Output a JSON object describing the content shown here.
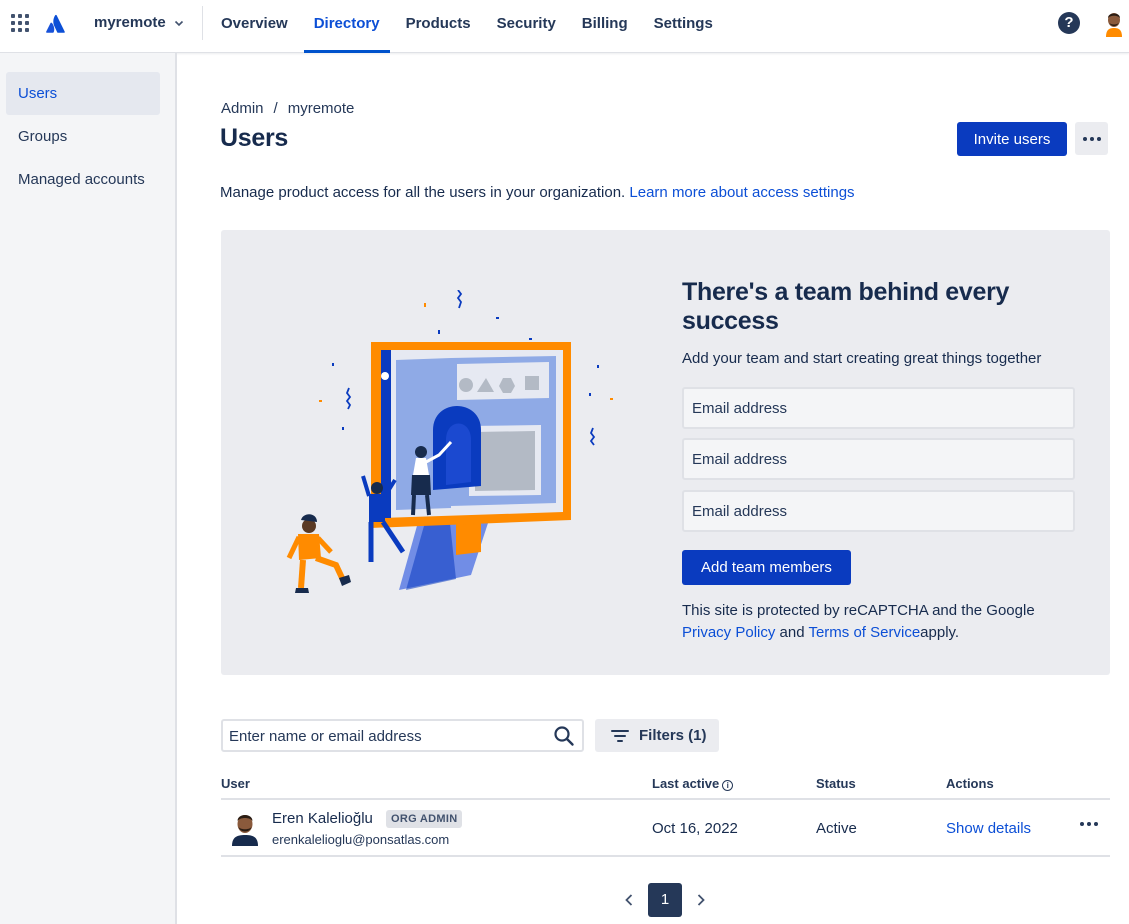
{
  "header": {
    "org_name": "myremote",
    "tabs": [
      {
        "label": "Overview"
      },
      {
        "label": "Directory"
      },
      {
        "label": "Products"
      },
      {
        "label": "Security"
      },
      {
        "label": "Billing"
      },
      {
        "label": "Settings"
      }
    ],
    "active_tab": "Directory",
    "help_symbol": "?"
  },
  "sidebar": {
    "items": [
      {
        "label": "Users"
      },
      {
        "label": "Groups"
      },
      {
        "label": "Managed accounts"
      }
    ],
    "active_item": "Users"
  },
  "main": {
    "breadcrumb": [
      "Admin",
      "/",
      "myremote"
    ],
    "title": "Users",
    "invite_button": "Invite users",
    "description": "Manage product access for all the users in your organization.",
    "description_link": "Learn more about access settings"
  },
  "promo": {
    "title": "There's a team behind every success",
    "subtitle": "Add your team and start creating great things together",
    "email_placeholder": "Email address",
    "add_button": "Add team members",
    "captcha_text_1": "This site is protected by reCAPTCHA and the Google",
    "privacy_link": "Privacy Policy",
    "and_text": "and",
    "terms_link": "Terms of Service",
    "apply_text": "apply."
  },
  "search": {
    "placeholder": "Enter name or email address",
    "filter_label": "Filters (1)"
  },
  "table": {
    "columns": {
      "user": "User",
      "last_active": "Last active",
      "status": "Status",
      "actions": "Actions"
    },
    "rows": [
      {
        "name": "Eren Kalelioğlu",
        "badge": "ORG ADMIN",
        "email": "erenkalelioglu@ponsatlas.com",
        "last_active": "Oct 16, 2022",
        "status": "Active",
        "action": "Show details"
      }
    ]
  },
  "pagination": {
    "current_page": "1"
  },
  "colors": {
    "primary": "#0a3bbf",
    "link": "#0c4fd6",
    "text": "#172b4d",
    "panel": "#ebecf0",
    "illustration_orange": "#ff8b00",
    "illustration_blue": "#0a3bbf"
  }
}
